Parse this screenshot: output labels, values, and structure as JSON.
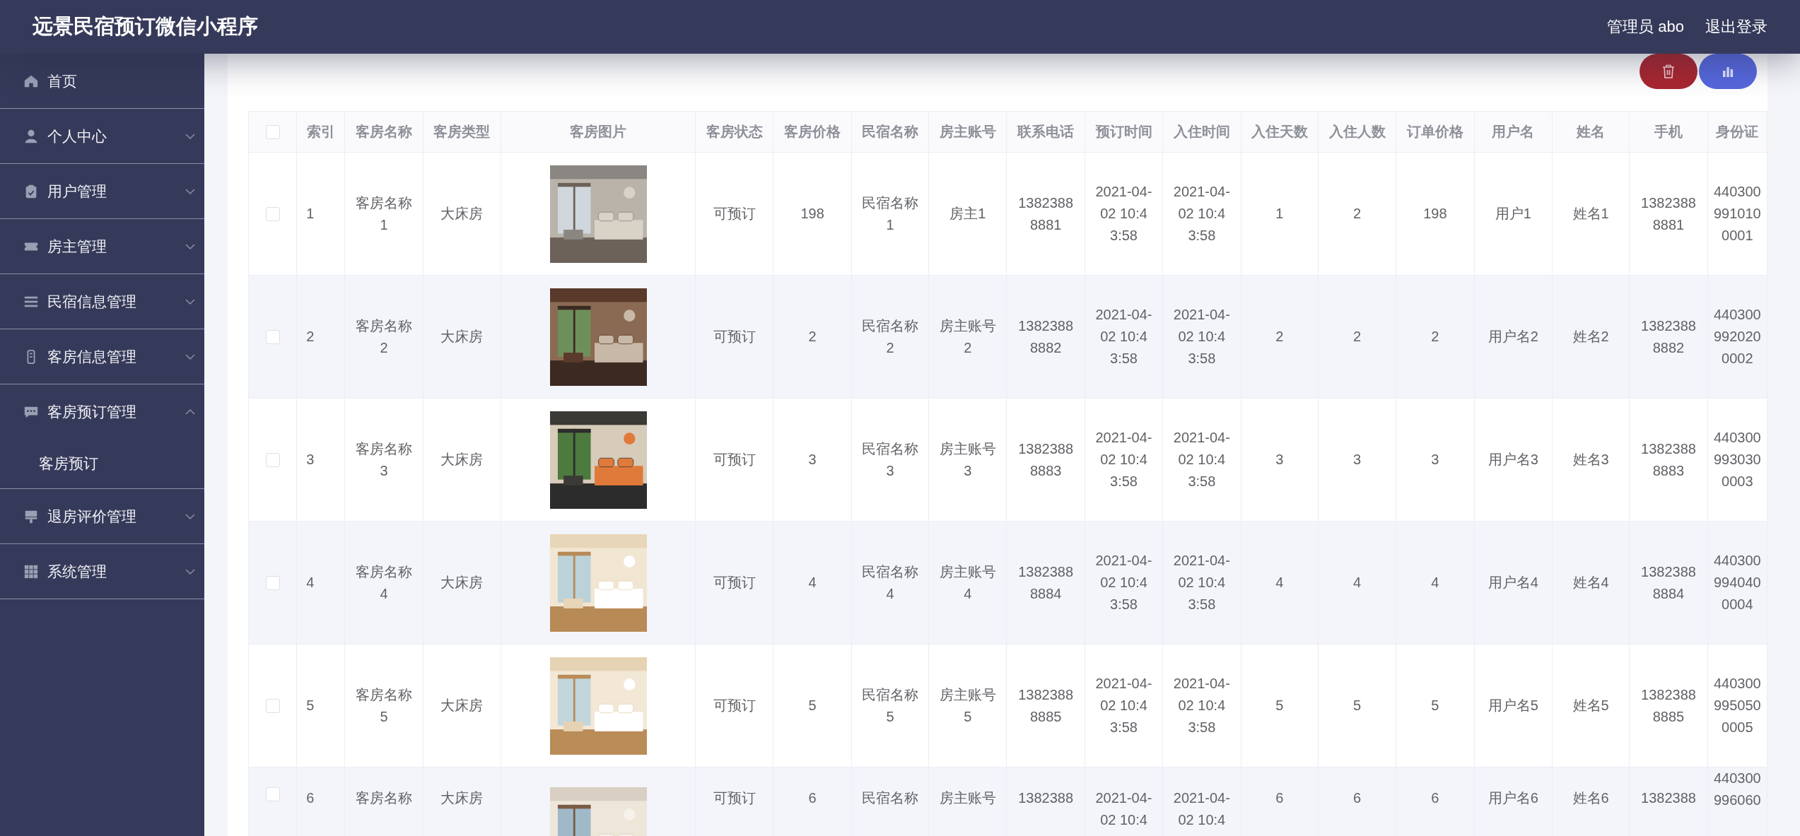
{
  "header": {
    "title": "远景民宿预订微信小程序",
    "user": "管理员 abo",
    "logout": "退出登录"
  },
  "sidebar": {
    "items": [
      {
        "label": "首页"
      },
      {
        "label": "个人中心",
        "expanded": false
      },
      {
        "label": "用户管理",
        "expanded": false
      },
      {
        "label": "房主管理",
        "expanded": false
      },
      {
        "label": "民宿信息管理",
        "expanded": false
      },
      {
        "label": "客房信息管理",
        "expanded": false
      },
      {
        "label": "客房预订管理",
        "expanded": true,
        "children": [
          {
            "label": "客房预订"
          }
        ]
      },
      {
        "label": "退房评价管理",
        "expanded": false
      },
      {
        "label": "系统管理",
        "expanded": false
      }
    ]
  },
  "toolbar": {
    "buttons": [
      {
        "kind": "delete"
      },
      {
        "kind": "chart"
      }
    ]
  },
  "table": {
    "select_all": {
      "checked": false
    },
    "columns": [
      "索引",
      "客房名称",
      "客房类型",
      "客房图片",
      "客房状态",
      "客房价格",
      "民宿名称",
      "房主账号",
      "联系电话",
      "预订时间",
      "入住时间",
      "入住天数",
      "入住人数",
      "订单价格",
      "用户名",
      "姓名",
      "手机",
      "身份证"
    ],
    "rows": [
      {
        "checked": false,
        "cells": [
          "1",
          "客房名称1",
          "大床房",
          {
            "kind": "picture"
          },
          "可预订",
          "198",
          "民宿名称1",
          "房主1",
          "13823888881",
          "2021-04-02 10:43:58",
          "2021-04-02 10:43:58",
          "1",
          "2",
          "198",
          "用户1",
          "姓名1",
          "13823888881",
          "4403009910100001"
        ]
      },
      {
        "checked": false,
        "cells": [
          "2",
          "客房名称2",
          "大床房",
          {
            "kind": "picture"
          },
          "可预订",
          "2",
          "民宿名称2",
          "房主账号2",
          "13823888882",
          "2021-04-02 10:43:58",
          "2021-04-02 10:43:58",
          "2",
          "2",
          "2",
          "用户名2",
          "姓名2",
          "13823888882",
          "4403009920200002"
        ]
      },
      {
        "checked": false,
        "cells": [
          "3",
          "客房名称3",
          "大床房",
          {
            "kind": "picture"
          },
          "可预订",
          "3",
          "民宿名称3",
          "房主账号3",
          "13823888883",
          "2021-04-02 10:43:58",
          "2021-04-02 10:43:58",
          "3",
          "3",
          "3",
          "用户名3",
          "姓名3",
          "13823888883",
          "4403009930300003"
        ]
      },
      {
        "checked": false,
        "cells": [
          "4",
          "客房名称4",
          "大床房",
          {
            "kind": "picture"
          },
          "可预订",
          "4",
          "民宿名称4",
          "房主账号4",
          "13823888884",
          "2021-04-02 10:43:58",
          "2021-04-02 10:43:58",
          "4",
          "4",
          "4",
          "用户名4",
          "姓名4",
          "13823888884",
          "4403009940400004"
        ]
      },
      {
        "checked": false,
        "cells": [
          "5",
          "客房名称5",
          "大床房",
          {
            "kind": "picture"
          },
          "可预订",
          "5",
          "民宿名称5",
          "房主账号5",
          "13823888885",
          "2021-04-02 10:43:58",
          "2021-04-02 10:43:58",
          "5",
          "5",
          "5",
          "用户名5",
          "姓名5",
          "13823888885",
          "4403009950500005"
        ]
      },
      {
        "checked": false,
        "cells": [
          "6",
          "客房名称",
          "大床房",
          {
            "kind": "picture"
          },
          "可预订",
          "6",
          "民宿名称",
          "房主账号",
          "1382388",
          "2021-04-02 10:4",
          "2021-04-02 10:4",
          "6",
          "6",
          "6",
          "用户名6",
          "姓名6",
          "1382388",
          "440300996060"
        ]
      }
    ]
  }
}
